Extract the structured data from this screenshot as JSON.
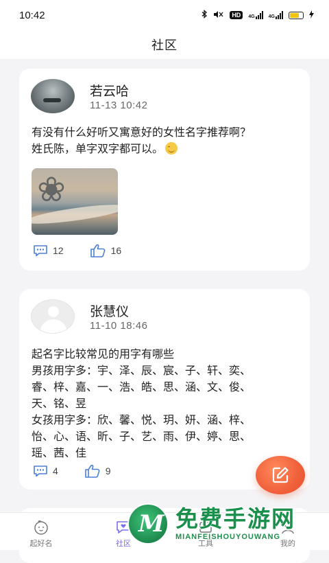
{
  "status_bar": {
    "time": "10:42",
    "hd_badge": "HD",
    "net1": "4G",
    "net2": "4G"
  },
  "header": {
    "title": "社区"
  },
  "posts": [
    {
      "user": "若云哈",
      "time": "11-13 10:42",
      "lines": [
        "有没有什么好听又寓意好的女性名字推荐啊？",
        "姓氏陈，单字双字都可以。"
      ],
      "has_emoji": true,
      "has_image": true,
      "comments": "12",
      "likes": "16"
    },
    {
      "user": "张慧仪",
      "time": "11-10 18:46",
      "lines": [
        "起名字比较常见的用字有哪些",
        "男孩用字多：宇、泽、辰、宸、子、轩、奕、",
        "睿、梓、嘉、一、浩、皓、思、涵、文、俊、",
        "天、铭、昱",
        "女孩用字多：欣、馨、悦、玥、妍、涵、梓、",
        "怡、心、语、昕、子、艺、雨、伊、婷、思、",
        "瑶、茜、佳"
      ],
      "comments": "4",
      "likes": "9"
    }
  ],
  "tabbar": {
    "tabs": [
      {
        "label": "起好名",
        "icon": "baby-face-icon"
      },
      {
        "label": "社区",
        "icon": "chat-heart-icon",
        "active": true
      },
      {
        "label": "工具",
        "icon": "tools-icon"
      },
      {
        "label": "我的",
        "icon": "profile-icon"
      }
    ]
  },
  "watermark": {
    "cn": "免费手游网",
    "en": "MIANFEISHOUYOUWANG"
  },
  "colors": {
    "accent": "#7a6cf0",
    "fab": "#f0603a",
    "icon_blue": "#4a7fd4"
  }
}
